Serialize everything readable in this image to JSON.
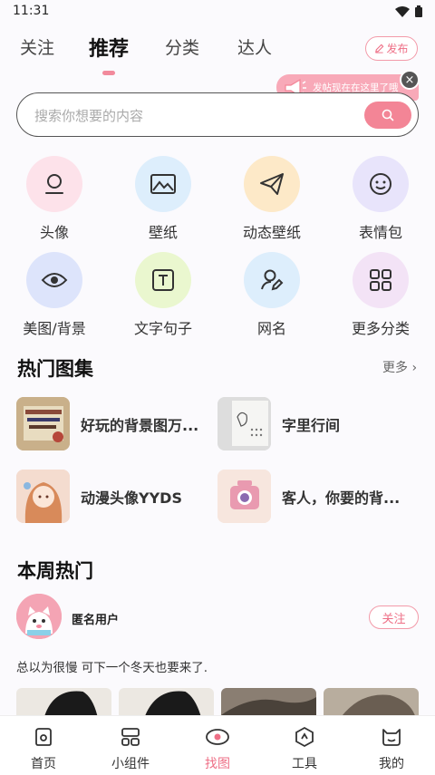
{
  "status_bar": {
    "time": "11:31"
  },
  "top_tabs": [
    {
      "label": "关注"
    },
    {
      "label": "推荐"
    },
    {
      "label": "分类"
    },
    {
      "label": "达人"
    }
  ],
  "publish_label": "发布",
  "tooltip": {
    "text": "发帖现在在这里了哦",
    "close": "×"
  },
  "search": {
    "placeholder": "搜索你想要的内容"
  },
  "categories": [
    {
      "label": "头像",
      "icon": "avatar-icon",
      "color": "#fde2ea"
    },
    {
      "label": "壁纸",
      "icon": "image-icon",
      "color": "#ddeefc"
    },
    {
      "label": "动态壁纸",
      "icon": "paper-plane-icon",
      "color": "#fde9c8"
    },
    {
      "label": "表情包",
      "icon": "emoji-icon",
      "color": "#e8e4fb"
    },
    {
      "label": "美图/背景",
      "icon": "eye-icon",
      "color": "#dde4fb"
    },
    {
      "label": "文字句子",
      "icon": "text-icon",
      "color": "#eaf7cf"
    },
    {
      "label": "网名",
      "icon": "user-edit-icon",
      "color": "#ddeefc"
    },
    {
      "label": "更多分类",
      "icon": "grid-icon",
      "color": "#f3e3f6"
    }
  ],
  "hot_albums": {
    "title": "热门图集",
    "more": "更多",
    "items": [
      {
        "title": "好玩的背景图万..."
      },
      {
        "title": "字里行间"
      },
      {
        "title": "动漫头像YYDS"
      },
      {
        "title": "客人，你要的背..."
      }
    ]
  },
  "weekly_hot": {
    "title": "本周热门",
    "user_name": "匿名用户",
    "follow": "关注",
    "post_text": "总以为很慢 可下一个冬天也要来了."
  },
  "bottom_nav": [
    {
      "label": "首页",
      "icon": "home-icon"
    },
    {
      "label": "小组件",
      "icon": "widget-icon"
    },
    {
      "label": "找图",
      "icon": "find-image-icon",
      "active": true
    },
    {
      "label": "工具",
      "icon": "tools-icon"
    },
    {
      "label": "我的",
      "icon": "profile-icon"
    }
  ],
  "colors": {
    "accent": "#ee6f86",
    "accent_light": "#f38596"
  }
}
